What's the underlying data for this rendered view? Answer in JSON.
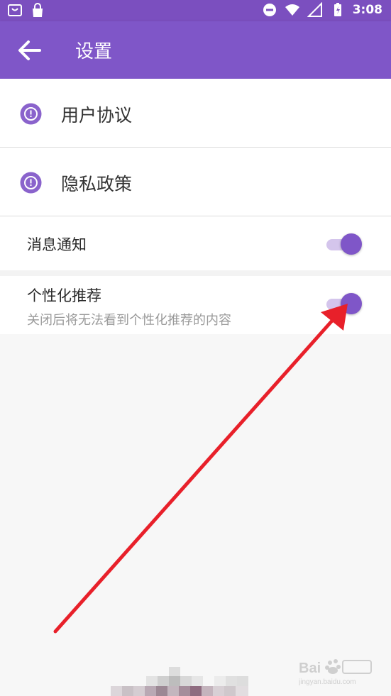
{
  "status_bar": {
    "time": "3:08"
  },
  "app_bar": {
    "title": "设置"
  },
  "links": [
    {
      "label": "用户协议"
    },
    {
      "label": "隐私政策"
    }
  ],
  "toggles": [
    {
      "label": "消息通知",
      "on": true
    },
    {
      "label": "个性化推荐",
      "subtitle": "关闭后将无法看到个性化推荐的内容",
      "on": true
    }
  ],
  "colors": {
    "accent": "#7f56c8",
    "annotation_arrow": "#e8202a"
  }
}
